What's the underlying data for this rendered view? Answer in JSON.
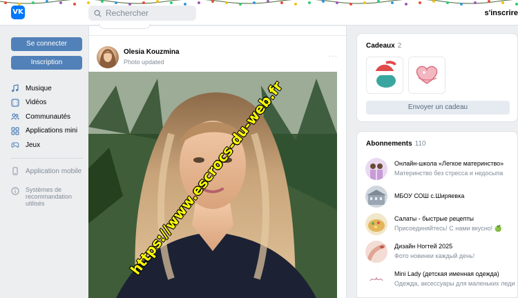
{
  "header": {
    "search_placeholder": "Rechercher",
    "signup_link": "s'inscrire"
  },
  "sidebar": {
    "login_button": "Se connecter",
    "register_button": "Inscription",
    "items": [
      {
        "label": "Musique",
        "icon": "music-icon"
      },
      {
        "label": "Vidéos",
        "icon": "video-icon"
      },
      {
        "label": "Communautés",
        "icon": "communities-icon"
      },
      {
        "label": "Applications mini",
        "icon": "apps-icon"
      },
      {
        "label": "Jeux",
        "icon": "gamepad-icon"
      }
    ],
    "mobile_app": "Application mobile",
    "recommendations": "Systèmes de recommandation utilisés"
  },
  "post": {
    "author": "Olesia Kouzmina",
    "subtitle": "Photo updated",
    "watermark": "https://www.escrocs-du-web.fr"
  },
  "gifts": {
    "title": "Cadeaux",
    "count": "2",
    "send_button": "Envoyer un cadeau"
  },
  "subscriptions": {
    "title": "Abonnements",
    "count": "110",
    "items": [
      {
        "name": "Онлайн-школа «Легкое материнство»",
        "desc": "Материнство без стресса и недосыпа"
      },
      {
        "name": "МБОУ СОШ с.Ширяевка",
        "desc": ""
      },
      {
        "name": "Салаты - быстрые рецепты",
        "desc": "Присоединяйтесь! С нами вкусно! 🍏"
      },
      {
        "name": "Дизайн Ногтей 2025",
        "desc": "Фото новинки каждый день!"
      },
      {
        "name": "Mini Lady (детская именная одежда)",
        "desc": "Одежда, аксессуары для маленьких леди"
      }
    ]
  },
  "colors": {
    "accent": "#5181b8",
    "brand": "#0077ff",
    "watermark": "#ffff00"
  }
}
